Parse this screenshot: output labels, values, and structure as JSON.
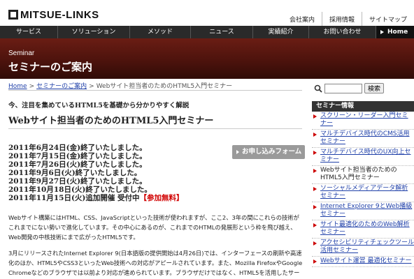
{
  "header": {
    "logo_text": "MITSUE-LINKS",
    "utility_nav": [
      "会社案内",
      "採用情報",
      "サイトマップ"
    ]
  },
  "global_nav": {
    "items": [
      "サービス",
      "ソリューション",
      "メソッド",
      "ニュース",
      "実績紹介",
      "お問い合わせ"
    ],
    "home": "Home"
  },
  "hero": {
    "eyebrow": "Seminar",
    "title": "セミナーのご案内"
  },
  "breadcrumb": {
    "items": [
      "Home",
      "セミナーのご案内"
    ],
    "current": "Webサイト担当者のためのHTML5入門セミナー"
  },
  "main": {
    "subtitle": "今、注目を集めているHTML5を基礎から分かりやすく解説",
    "title": "Webサイト担当者のためのHTML5入門セミナー",
    "apply_button": "お申し込みフォーム",
    "dates": [
      "2011年6月24日(金)終了いたしました。",
      "2011年7月15日(金)終了いたしました。",
      "2011年7月26日(火)終了いたしました。",
      "2011年9月6日(火)終了いたしました。",
      "2011年9月27日(火)終了いたしました。",
      "2011年10月18日(火)終了いたしました。"
    ],
    "final_date_prefix": "2011年11月15日(火)追加開催 受付中",
    "final_date_badge": "【参加無料】",
    "paragraph1": "Webサイト構築にはHTML、CSS、JavaScriptといった技術が使われますが、ここ2、3年の間にこれらの技術がこれまでにない勢いで進化しています。その中心にあるのが、これまでのHTMLの発展形という枠を飛び越え、Web開発の中核技術にまで広がったHTML5です。",
    "paragraph2": "3月にリリースされたInternet Explorer 9(日本語版の提供開始は4月26日)では、インターフェースの刷新や高速化のほか、HTML5やCSS3といったWeb技術への対応がアピールされています。また、Mozilla FirefoxやGoogle Chromeなどのブラウザでは以前より対応が進められています。ブラウザだけではなく、HTML5を活用したサービスやアプリケーションも登場"
  },
  "sidebar": {
    "search_button": "検索",
    "heading": "セミナー情報",
    "items": [
      "スクリーン・リーダー入門セミナー",
      "マルチデバイス時代のCMS活用セミナー",
      "マルチデバイス時代のUX向上セミナー",
      "Webサイト担当者のためのHTML5入門セミナー",
      "ソーシャルメディアデータ解析セミナー",
      "Internet Explorer 9とWeb播級セミナー",
      "サイト最適化のためのWeb解析セミナー",
      "アクセシビリティチェックツール活用セミナー",
      "Webサイト運営 最適化セミナー"
    ]
  },
  "colors": {
    "hero_bg": "#5a170f",
    "nav_bg": "#2a2a2a",
    "link": "#1e3fa8",
    "accent_red": "#d10000"
  }
}
